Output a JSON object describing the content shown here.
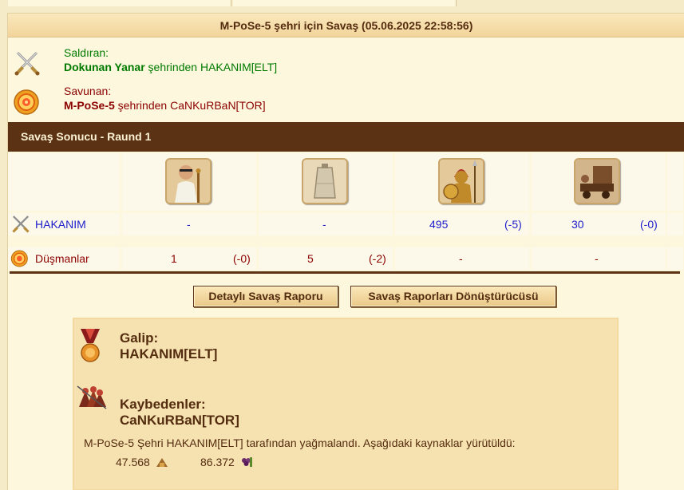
{
  "battle": {
    "title": "M-PoSe-5 şehri için Savaş (05.06.2025 22:58:56)",
    "attacker": {
      "label": "Saldıran:",
      "city": "Dokunan Yanar",
      "middle": " şehrinden ",
      "player": "HAKANIM[ELT]",
      "icon": "crossed-swords-icon"
    },
    "defender": {
      "label": "Savunan:",
      "city": "M-PoSe-5",
      "middle": " şehrinden ",
      "player": "CaNKuRBaN[TOR]",
      "icon": "shield-icon"
    },
    "round_title": "Savaş Sonucu - Raund 1",
    "units": [
      "citizen-unit-icon",
      "wall-unit-icon",
      "hoplite-unit-icon",
      "ram-unit-icon"
    ],
    "rows": [
      {
        "name": "HAKANIM",
        "icon": "crossed-swords-icon",
        "cells": [
          {
            "value": "-",
            "loss": ""
          },
          {
            "value": "-",
            "loss": ""
          },
          {
            "value": "495",
            "loss": "(-5)"
          },
          {
            "value": "30",
            "loss": "(-0)"
          }
        ]
      },
      {
        "name": "Düşmanlar",
        "icon": "shield-icon",
        "cells": [
          {
            "value": "1",
            "loss": "(-0)"
          },
          {
            "value": "5",
            "loss": "(-2)"
          },
          {
            "value": "-",
            "loss": ""
          },
          {
            "value": "-",
            "loss": ""
          }
        ]
      }
    ],
    "buttons": {
      "detailed": "Detaylı Savaş Raporu",
      "converter": "Savaş Raporları Dönüştürücüsü"
    },
    "summary": {
      "winner_label": "Galip:",
      "winner": "HAKANIM[ELT]",
      "losers_label": "Kaybedenler:",
      "losers": "CaNKuRBaN[TOR]",
      "message": "M-PoSe-5 Şehri HAKANIM[ELT] tarafından yağmalandı. Aşağıdaki kaynaklar yürütüldü:",
      "resources": [
        {
          "amount": "47.568",
          "icon": "wood-icon"
        },
        {
          "amount": "86.372",
          "icon": "wine-icon"
        }
      ]
    }
  }
}
